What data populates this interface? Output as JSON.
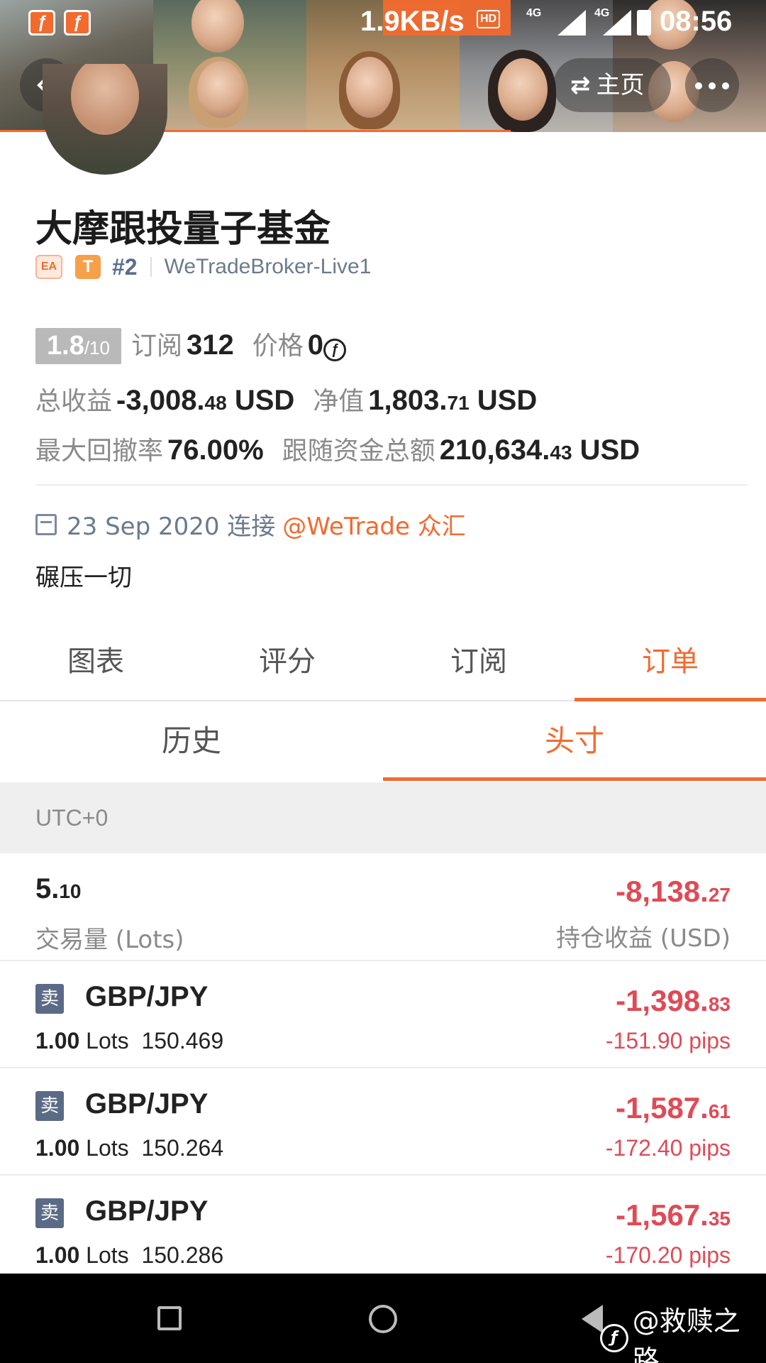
{
  "status_bar": {
    "net_speed": "1.9KB/s",
    "hd_label": "HD",
    "net_type_1": "4G",
    "net_type_2": "4G",
    "time": "08:56",
    "app_icon_glyph": "ƒ"
  },
  "header": {
    "home_label": "主页",
    "swap_glyph": "⇄"
  },
  "profile": {
    "name": "大摩跟投量子基金",
    "badge_ea": "EA",
    "badge_t": "T",
    "rank": "#2",
    "broker": "WeTradeBroker-Live1",
    "score_main": "1.8",
    "score_total": "/10",
    "subscribe_label": "订阅",
    "subscribe_count": "312",
    "price_label": "价格",
    "price_value": "0",
    "coin_glyph": "ƒ",
    "total_profit_label": "总收益",
    "total_profit_int": "-3,008.",
    "total_profit_dec": "48",
    "total_profit_unit": " USD",
    "equity_label": "净值",
    "equity_int": "1,803.",
    "equity_dec": "71",
    "equity_unit": " USD",
    "max_drawdown_label": "最大回撤率",
    "max_drawdown_value": "76.00%",
    "follow_funds_label": "跟随资金总额",
    "follow_funds_int": "210,634.",
    "follow_funds_dec": "43",
    "follow_funds_unit": " USD",
    "connect_date": "23 Sep 2020 连接",
    "connect_link": "@WeTrade 众汇",
    "bio": "碾压一切"
  },
  "tabs": [
    {
      "label": "图表"
    },
    {
      "label": "评分"
    },
    {
      "label": "订阅"
    },
    {
      "label": "订单"
    }
  ],
  "subtabs": [
    {
      "label": "历史"
    },
    {
      "label": "头寸"
    }
  ],
  "timezone": "UTC+0",
  "summary": {
    "lots_int": "5.",
    "lots_dec": "10",
    "lots_label": "交易量 (Lots)",
    "pnl_int": "-8,138.",
    "pnl_dec": "27",
    "pnl_label": "持仓收益 (USD)"
  },
  "orders": [
    {
      "side": "卖",
      "symbol": "GBP/JPY",
      "lots": "1.00",
      "lots_unit": " Lots",
      "price": "150.469",
      "pnl_int": "-1,398.",
      "pnl_dec": "83",
      "pips": "-151.90 pips"
    },
    {
      "side": "卖",
      "symbol": "GBP/JPY",
      "lots": "1.00",
      "lots_unit": " Lots",
      "price": "150.264",
      "pnl_int": "-1,587.",
      "pnl_dec": "61",
      "pips": "-172.40 pips"
    },
    {
      "side": "卖",
      "symbol": "GBP/JPY",
      "lots": "1.00",
      "lots_unit": " Lots",
      "price": "150.286",
      "pnl_int": "-1,567.",
      "pnl_dec": "35",
      "pips": "-170.20 pips"
    }
  ],
  "watermark": {
    "text": "@救赎之路",
    "logo_glyph": "ƒ"
  },
  "colors": {
    "accent": "#f26a2e",
    "loss": "#e04a56",
    "sell_badge": "#5b6a86"
  }
}
